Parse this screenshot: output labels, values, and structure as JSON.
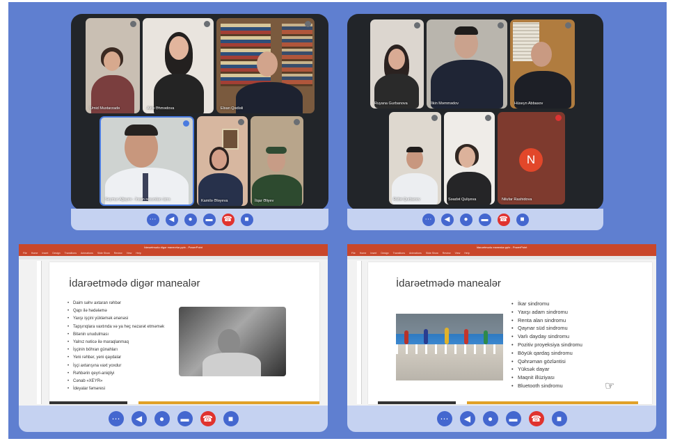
{
  "top_left": {
    "participants": [
      {
        "name": "Umid Muxtarzadə",
        "id": "tl1"
      },
      {
        "name": "Aidə Əhmədova",
        "id": "tl2"
      },
      {
        "name": "Elxan Qədiəli",
        "id": "tl3"
      },
      {
        "name": "Seymur Ağayev - İnsan resursları üzrə",
        "id": "tl4"
      },
      {
        "name": "Kamilə Ələyeva",
        "id": "tl5"
      },
      {
        "name": "İlqar Əliyev",
        "id": "tl6"
      }
    ],
    "controls": [
      "more",
      "speaker",
      "mic",
      "chat",
      "end-call",
      "camera"
    ]
  },
  "top_right": {
    "participants": [
      {
        "name": "Ruyana Gurbanova",
        "id": "tr1"
      },
      {
        "name": "İlkin Məmmədov",
        "id": "tr2"
      },
      {
        "name": "Hüseyn Abbasov",
        "id": "tr3"
      },
      {
        "name": "Rüfət Qurbanov",
        "id": "tr4"
      },
      {
        "name": "Səadət Quliyeva",
        "id": "tr5"
      },
      {
        "name": "Nilufar Rashidova",
        "id": "tr6",
        "initial": "N"
      }
    ],
    "controls": [
      "more",
      "speaker",
      "mic",
      "chat",
      "end-call",
      "camera"
    ]
  },
  "bottom_left": {
    "app_title": "İdarəetmədə digər manevrlər.pptx - PowerPoint",
    "ribbon": [
      "File",
      "Home",
      "Insert",
      "Design",
      "Transitions",
      "Animations",
      "Slide Show",
      "Review",
      "View",
      "Help"
    ],
    "slide_title": "İdarəetmədə digər manealər",
    "bullets": [
      "Daim səhv axtaran rəhbər",
      "Qapı ilə hədələmə",
      "Yaxşı işçini yükləmək ənənəsi",
      "Tapşırıqlara vaxtında və ya heç nəzarət etməmək",
      "Bitənin unudulması",
      "Yalnız nəticə ilə maraqlanmaq",
      "İşçinin böhran günahları",
      "Yeni rəhbər, yeni qaydalar",
      "İşçi axtarışına vaxt yoxdur",
      "Rəhbərin qeyri-aniqliyi",
      "Cənab «XEYR»",
      "İdeyalar fəməresi"
    ],
    "controls": [
      "more",
      "speaker",
      "mic",
      "chat",
      "end-call",
      "camera"
    ]
  },
  "bottom_right": {
    "app_title": "İdarəetmədə manealər.pptx - PowerPoint",
    "ribbon": [
      "File",
      "Home",
      "Insert",
      "Design",
      "Transitions",
      "Animations",
      "Slide Show",
      "Review",
      "View",
      "Help"
    ],
    "slide_title": "İdarəetmədə manealər",
    "bullets": [
      "İkar sindromu",
      "Yaxşı adam sindromu",
      "Renta alan sindromu",
      "Qaynar süd sindromu",
      "Varlı dayday sindromu",
      "Pozitiv proyeksiya sindromu",
      "Böyük qardaş sindromu",
      "Qəhrəman gözləntisi",
      "Yüksək dayar",
      "Maqnit illüziyası",
      "Bluetooth sindromu"
    ],
    "controls": [
      "more",
      "speaker",
      "mic",
      "chat",
      "end-call",
      "camera"
    ]
  },
  "icons": {
    "more": "⋯",
    "speaker": "◀",
    "mic": "●",
    "chat": "▬",
    "end-call": "☎",
    "camera": "■"
  }
}
